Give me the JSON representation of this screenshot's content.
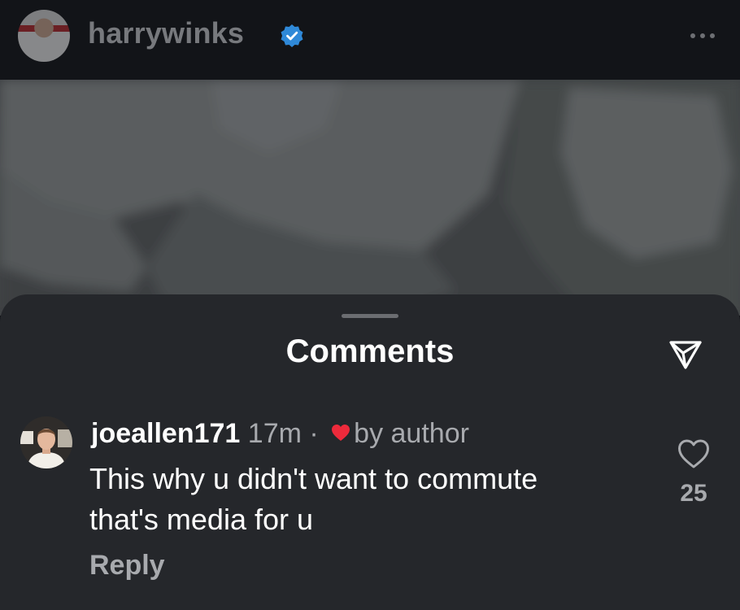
{
  "header": {
    "username": "harrywinks",
    "verified_icon": "verified-badge-icon",
    "more_icon": "more-horizontal-icon"
  },
  "sheet": {
    "title": "Comments",
    "share_icon": "send-icon"
  },
  "comment": {
    "username": "joeallen171",
    "time": "17m",
    "separator": "·",
    "liked_by_author_icon": "heart-icon",
    "liked_by_author_text": "by author",
    "text_line1": "This why u didn't want to commute",
    "text_line2": "that's media for u",
    "reply_label": "Reply",
    "like_icon": "heart-outline-icon",
    "like_count": "25"
  },
  "colors": {
    "background": "#0f1115",
    "sheet": "#25272b",
    "verified": "#2f89d8",
    "heart": "#ed2a3b",
    "muted_text": "#a8aaae"
  }
}
